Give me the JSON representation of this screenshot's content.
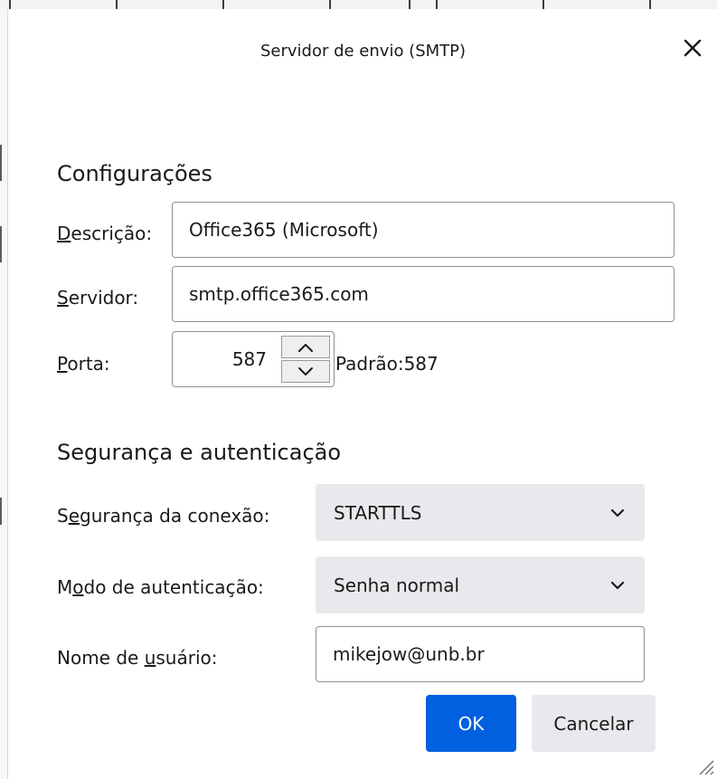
{
  "dialog": {
    "title": "Servidor de envio (SMTP)",
    "close_icon": "close-icon"
  },
  "settings": {
    "heading": "Configurações",
    "description": {
      "label_accesskey": "D",
      "label_rest": "escrição:",
      "value": "Office365 (Microsoft)"
    },
    "server": {
      "label_accesskey": "S",
      "label_rest": "ervidor:",
      "value": "smtp.office365.com"
    },
    "port": {
      "label_accesskey": "P",
      "label_rest": "orta:",
      "value": "587",
      "default_text": "Padrão:587",
      "up_icon": "chevron-up-icon",
      "down_icon": "chevron-down-icon"
    }
  },
  "security": {
    "heading": "Segurança e autenticação",
    "connection": {
      "label_pre": "S",
      "label_accesskey": "e",
      "label_post": "gurança da conexão:",
      "selected": "STARTTLS"
    },
    "auth": {
      "label_pre": "M",
      "label_accesskey": "o",
      "label_post": "do de autenticação:",
      "selected": "Senha normal"
    },
    "username": {
      "label_pre": "Nome de ",
      "label_accesskey": "u",
      "label_post": "suário:",
      "value": "mikejow@unb.br"
    }
  },
  "buttons": {
    "ok": "OK",
    "cancel": "Cancelar"
  },
  "colors": {
    "accent": "#0060df",
    "button_bg": "#e9e9ed",
    "text": "#1a1a1a",
    "field_border": "#8f8f8f"
  }
}
